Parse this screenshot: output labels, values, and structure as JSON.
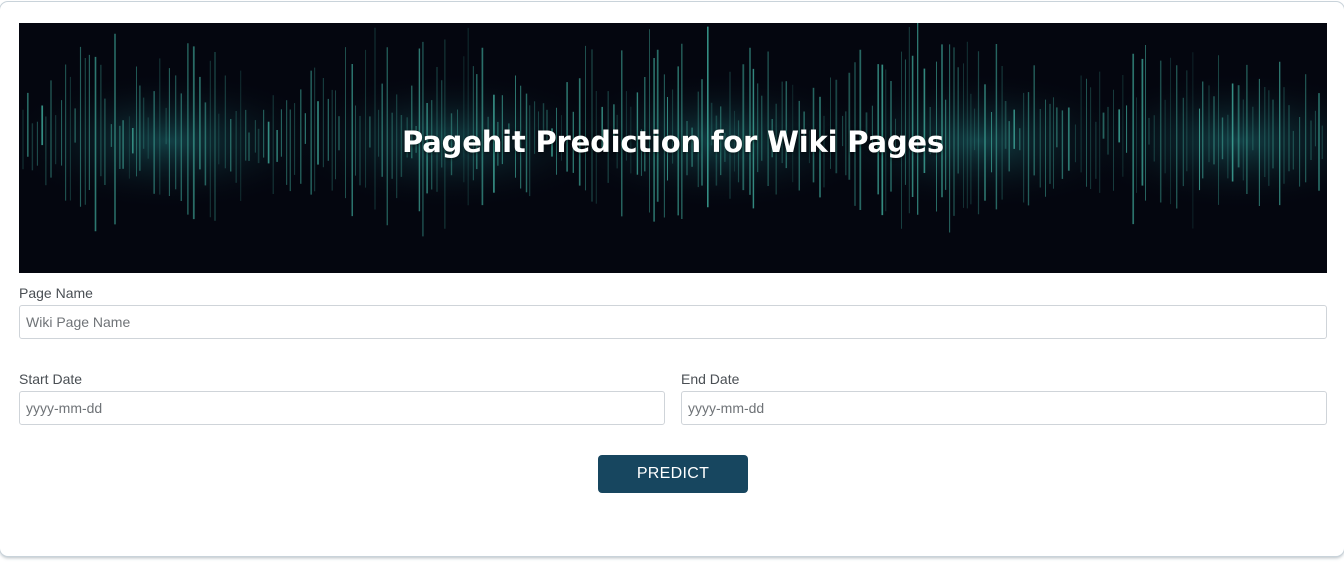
{
  "banner": {
    "title": "Pagehit Prediction for Wiki Pages",
    "accent_color": "#3fa89a",
    "background_color": "#04060f"
  },
  "form": {
    "page_name": {
      "label": "Page Name",
      "placeholder": "Wiki Page Name"
    },
    "start_date": {
      "label": "Start Date",
      "placeholder": "yyyy-mm-dd"
    },
    "end_date": {
      "label": "End Date",
      "placeholder": "yyyy-mm-dd"
    },
    "predict_button": {
      "label": "PREDICT",
      "color": "#17465f"
    }
  }
}
